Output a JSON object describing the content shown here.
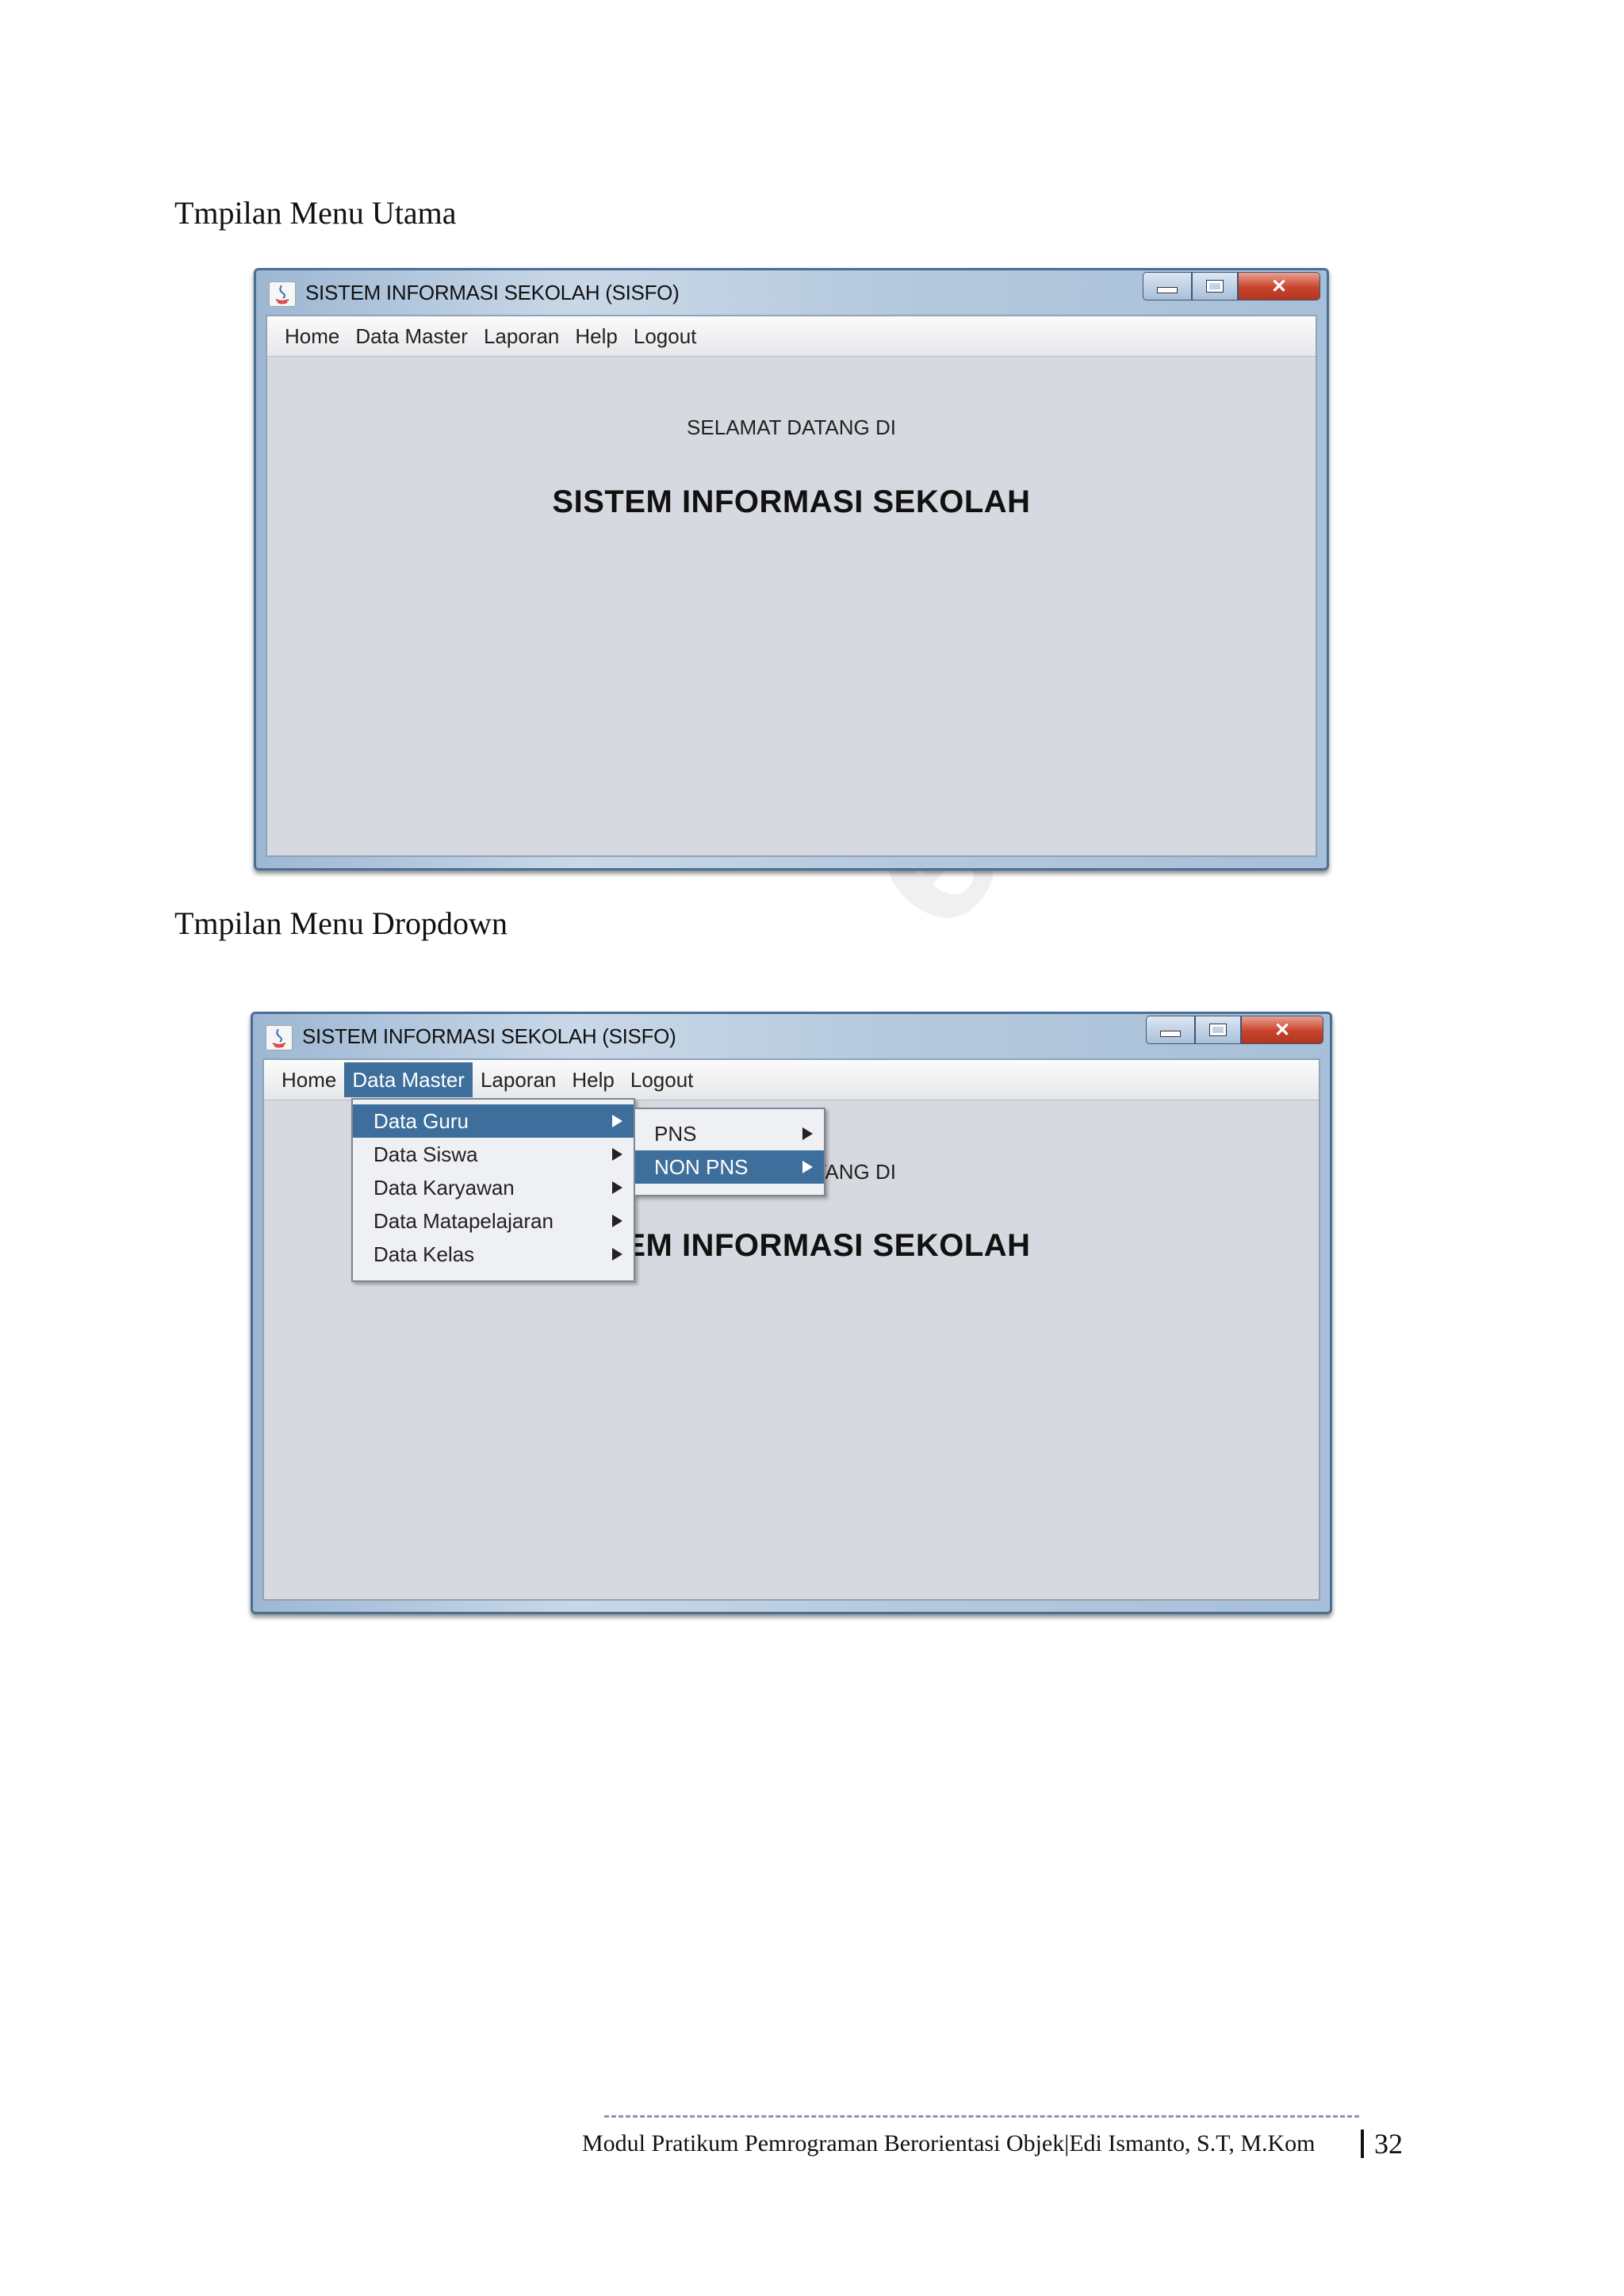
{
  "captions": {
    "main_menu": "Tmpilan Menu Utama",
    "dropdown_menu": "Tmpilan Menu Dropdown"
  },
  "window": {
    "title": "SISTEM INFORMASI SEKOLAH (SISFO)",
    "menu": [
      "Home",
      "Data Master",
      "Laporan",
      "Help",
      "Logout"
    ],
    "welcome": "SELAMAT DATANG DI",
    "app_name": "SISTEM INFORMASI SEKOLAH"
  },
  "dropdown": {
    "open_menu": "Data Master",
    "items": [
      "Data Guru",
      "Data Siswa",
      "Data Karyawan",
      "Data Matapelajaran",
      "Data Kelas"
    ],
    "selected_item": "Data Guru",
    "submenu": [
      "PNS",
      "NON PNS"
    ],
    "selected_submenu": "NON PNS"
  },
  "footer": {
    "text": "Modul Pratikum Pemrograman Berorientasi Objek|Edi Ismanto, S.T, M.Kom",
    "page_number": "32"
  },
  "colors": {
    "selection": "#3e6e9b",
    "window_background": "#d6d9df",
    "close_button": "#c8432b"
  }
}
